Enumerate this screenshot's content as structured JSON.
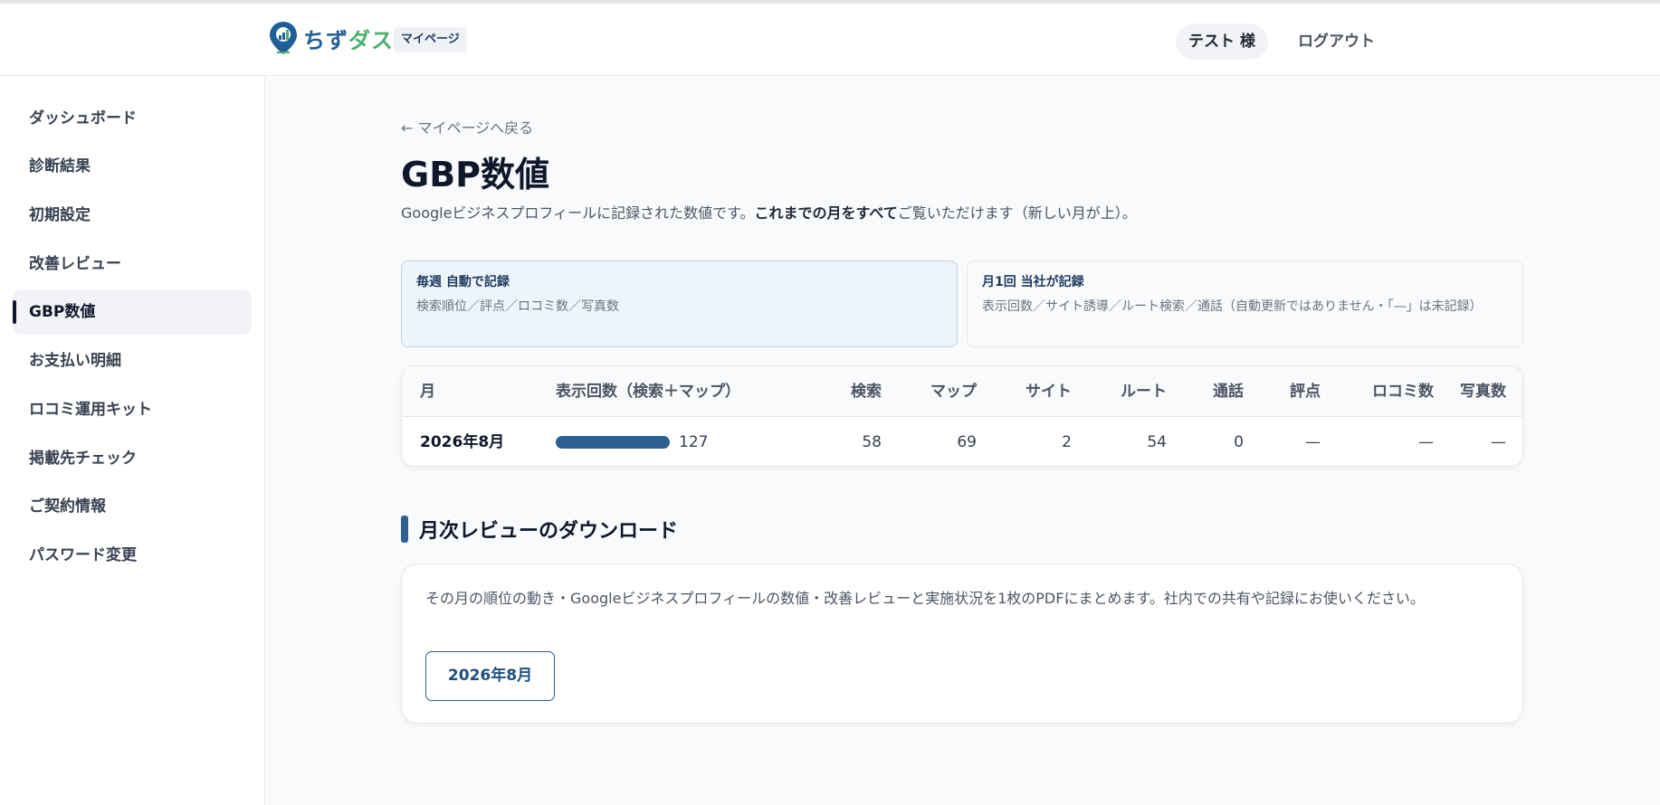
{
  "header": {
    "logo_text_a": "ちず",
    "logo_text_b": "ダス",
    "mypage_badge": "マイページ",
    "user": "テスト 様",
    "logout": "ログアウト"
  },
  "sidebar": {
    "items": [
      {
        "label": "ダッシュボード"
      },
      {
        "label": "診断結果"
      },
      {
        "label": "初期設定"
      },
      {
        "label": "改善レビュー"
      },
      {
        "label": "GBP数値"
      },
      {
        "label": "お支払い明細"
      },
      {
        "label": "ロコミ運用キット"
      },
      {
        "label": "掲載先チェック"
      },
      {
        "label": "ご契約情報"
      },
      {
        "label": "パスワード変更"
      }
    ],
    "active_index": 4
  },
  "main": {
    "back_link": "← マイページへ戻る",
    "title": "GBP数値",
    "lead_pre": "Googleビジネスプロフィールに記録された数値です。",
    "lead_bold": "これまでの月をすべて",
    "lead_post": "ご覧いただけます（新しい月が上）。",
    "card_weekly": {
      "title": "毎週 自動で記録",
      "desc": "検索順位／評点／ロコミ数／写真数"
    },
    "card_monthly": {
      "title": "月1回 当社が記録",
      "desc": "表示回数／サイト誘導／ルート検索／通話（自動更新ではありません・「—」は未記録）"
    },
    "table": {
      "headers": [
        "月",
        "表示回数（検索＋マップ）",
        "検索",
        "マップ",
        "サイト",
        "ルート",
        "通話",
        "評点",
        "ロコミ数",
        "写真数"
      ],
      "rows": [
        {
          "month": "2026年8月",
          "impressions": "127",
          "impressions_fill": 1.0,
          "search": "58",
          "map": "69",
          "site": "2",
          "route": "54",
          "call": "0",
          "rating": "—",
          "reviews": "—",
          "photos": "—"
        }
      ]
    },
    "download": {
      "section_title": "月次レビューのダウンロード",
      "description": "その月の順位の動き・Googleビジネスプロフィールの数値・改善レビューと実施状況を1枚のPDFにまとめます。社内での共有や記録にお使いください。",
      "button_label": "2026年8月"
    }
  },
  "colors": {
    "accent": "#2c5f92",
    "bar": "#2c5f92",
    "logo_blue": "#1f5f99",
    "logo_green": "#4caf6e"
  }
}
